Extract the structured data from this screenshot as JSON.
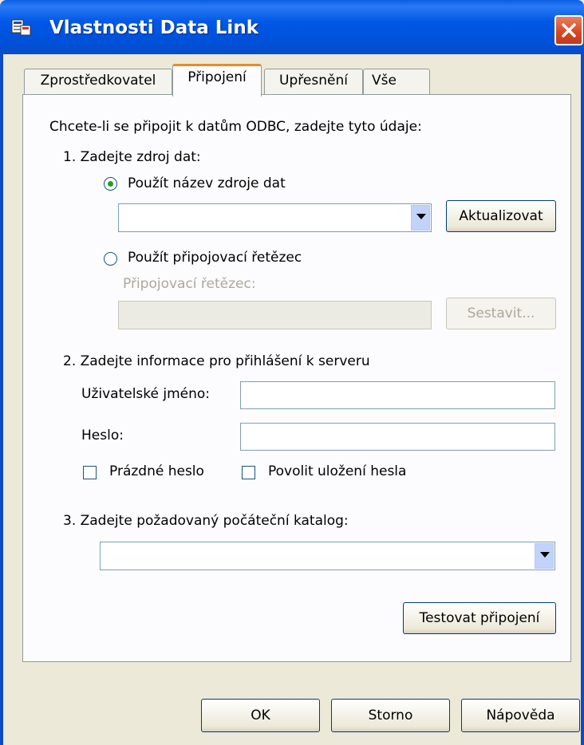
{
  "window": {
    "title": "Vlastnosti Data Link",
    "icon": "datalink-app-icon"
  },
  "tabs": [
    {
      "label": "Zprostředkovatel",
      "active": false
    },
    {
      "label": "Připojení",
      "active": true
    },
    {
      "label": "Upřesnění",
      "active": false
    },
    {
      "label": "Vše",
      "active": false
    }
  ],
  "connection": {
    "intro": "Chcete-li se připojit k datům ODBC, zadejte tyto údaje:",
    "step1": {
      "heading": "1. Zadejte zdroj dat:",
      "radio_dsn_label": "Použít název zdroje dat",
      "dsn_value": "",
      "refresh_button": "Aktualizovat",
      "radio_connstr_label": "Použít připojovací řetězec",
      "connstr_label": "Připojovací řetězec:",
      "connstr_value": "",
      "build_button": "Sestavit..."
    },
    "step2": {
      "heading": "2. Zadejte informace pro přihlášení k serveru",
      "username_label": "Uživatelské jméno:",
      "username_value": "",
      "password_label": "Heslo:",
      "password_value": "",
      "blank_password_label": "Prázdné heslo",
      "allow_save_label": "Povolit uložení hesla"
    },
    "step3": {
      "heading": "3. Zadejte požadovaný počáteční katalog:",
      "catalog_value": ""
    },
    "test_button": "Testovat připojení"
  },
  "footer": {
    "ok": "OK",
    "cancel": "Storno",
    "help": "Nápověda"
  },
  "colors": {
    "titlebar": "#0058e6",
    "dialog_bg": "#ece9d8",
    "panel_bg": "#fcfcfe",
    "active_tab_accent": "#e68b2c",
    "close_button": "#d64424"
  }
}
